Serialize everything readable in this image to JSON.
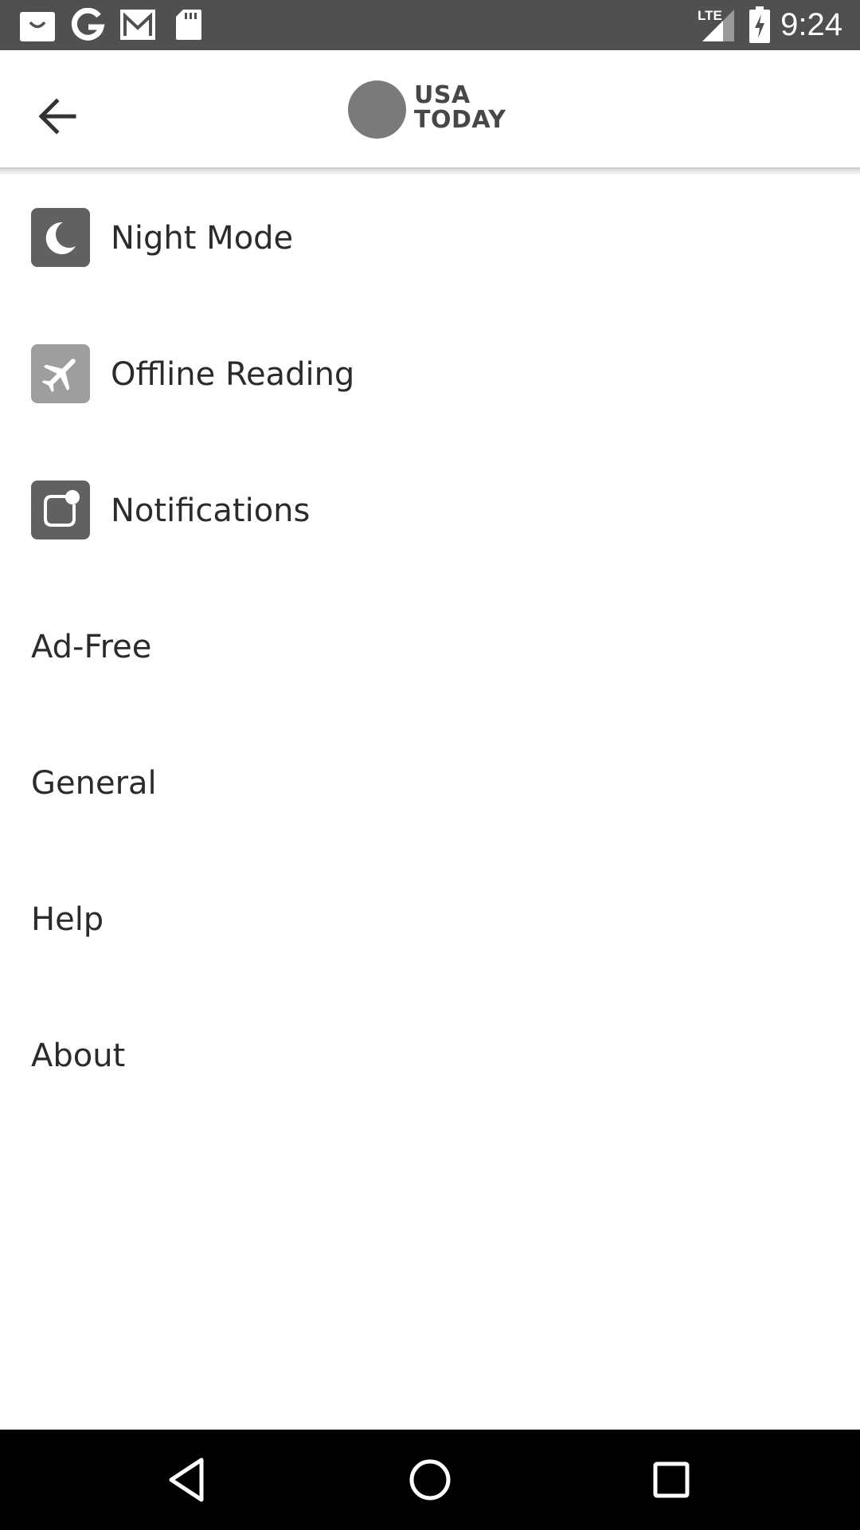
{
  "status_bar": {
    "time": "9:24",
    "network": "LTE",
    "icons": [
      "shopping-bag-icon",
      "google-icon",
      "gmail-icon",
      "sd-card-icon",
      "signal-icon",
      "battery-charging-icon"
    ]
  },
  "header": {
    "logo_line1": "USA",
    "logo_line2": "TODAY",
    "back_icon": "arrow-back-icon"
  },
  "menu": {
    "items": [
      {
        "label": "Night Mode",
        "icon": "moon-icon"
      },
      {
        "label": "Offline Reading",
        "icon": "airplane-icon"
      },
      {
        "label": "Notifications",
        "icon": "notification-badge-icon"
      },
      {
        "label": "Ad-Free"
      },
      {
        "label": "General"
      },
      {
        "label": "Help"
      },
      {
        "label": "About"
      }
    ]
  },
  "nav_bar": {
    "icons": [
      "back-triangle-icon",
      "home-circle-icon",
      "recents-square-icon"
    ]
  },
  "colors": {
    "status_bar_bg": "#505050",
    "nav_bar_bg": "#000000",
    "icon_tile_dark": "#616161",
    "icon_tile_light": "#9e9e9e",
    "text": "#2b2b2b"
  }
}
